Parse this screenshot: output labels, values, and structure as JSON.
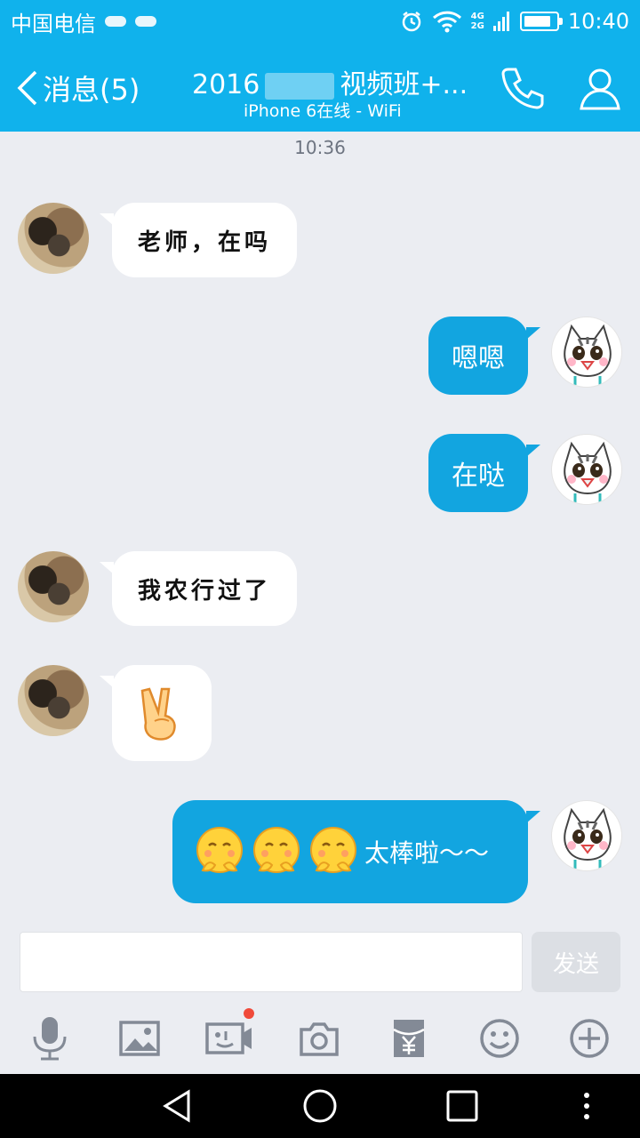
{
  "status_bar": {
    "carrier": "中国电信",
    "network_top": "4G",
    "network_bottom": "2G",
    "time": "10:40",
    "battery_level": 0.85
  },
  "header": {
    "back_label": "消息(5)",
    "title_prefix": "2016",
    "title_suffix": "视频班+...",
    "subtitle": "iPhone 6在线 - WiFi"
  },
  "timestamp": "10:36",
  "messages": [
    {
      "side": "in",
      "text": "老师，在吗"
    },
    {
      "side": "out",
      "text": "嗯嗯"
    },
    {
      "side": "out",
      "text": "在哒"
    },
    {
      "side": "in",
      "text": "我农行过了"
    },
    {
      "side": "in",
      "emoji": "victory-hand"
    },
    {
      "side": "out",
      "text": "太棒啦～～",
      "emoji": "smiling-face x3"
    }
  ],
  "composer": {
    "input_value": "",
    "send_label": "发送"
  },
  "toolbar": [
    "microphone-icon",
    "image-icon",
    "video-icon",
    "camera-icon",
    "red-packet-icon",
    "emoji-icon",
    "plus-icon"
  ],
  "colors": {
    "brand": "#10b2ec",
    "bubble_out": "#12a5e0",
    "background": "#ebedf2",
    "badge_dot": "#f04a3a"
  }
}
